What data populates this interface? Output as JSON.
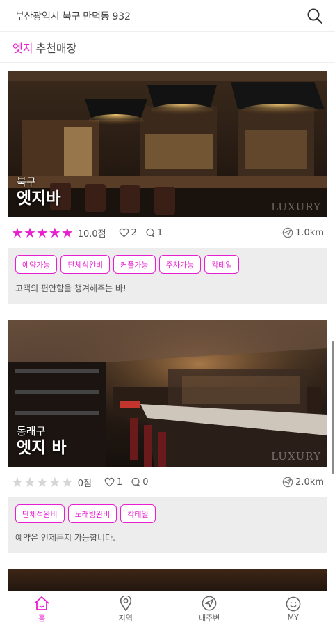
{
  "header": {
    "address": "부산광역시 북구 만덕동 932",
    "search_icon": "search-icon"
  },
  "section": {
    "accent": "엣지",
    "title": "추천매장"
  },
  "stores": [
    {
      "district": "북구",
      "name": "엣지바",
      "watermark": "LUXURY",
      "rating": 5,
      "score_label": "10.0점",
      "likes": "2",
      "comments": "1",
      "distance": "1.0km",
      "tags": [
        "예약가능",
        "단체석완비",
        "커플가능",
        "주차가능",
        "칵테일"
      ],
      "description": "고객의 편안함을 챙겨해주는 바!"
    },
    {
      "district": "동래구",
      "name": "엣지 바",
      "watermark": "LUXURY",
      "rating": 0,
      "score_label": "0점",
      "likes": "1",
      "comments": "0",
      "distance": "2.0km",
      "tags": [
        "단체석완비",
        "노래방완비",
        "칵테일"
      ],
      "description": "예약은 언제든지 가능합니다."
    }
  ],
  "nav": [
    {
      "label": "홈",
      "icon": "home-icon",
      "active": true
    },
    {
      "label": "지역",
      "icon": "location-pin-icon",
      "active": false
    },
    {
      "label": "내주변",
      "icon": "navigation-arrow-icon",
      "active": false
    },
    {
      "label": "MY",
      "icon": "smiley-face-icon",
      "active": false
    }
  ],
  "colors": {
    "accent": "#e81fd0",
    "info_bg": "#ededed",
    "star_off": "#d6d6d6"
  }
}
